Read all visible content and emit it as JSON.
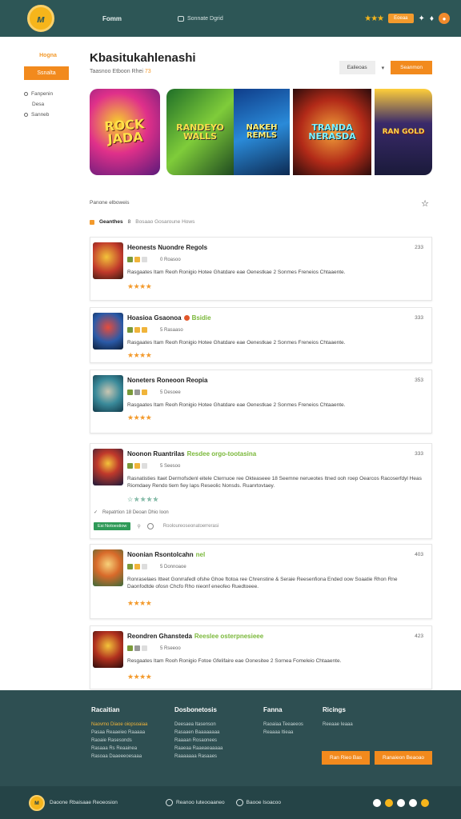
{
  "header": {
    "logo_text": "ᴍ",
    "nav_primary": "Fomm",
    "nav_secondary": "Sonnate Dgrid",
    "badge": "Eoeaa",
    "stars": "★★★",
    "icons": [
      "pin-icon",
      "bell-icon",
      "profile-icon"
    ]
  },
  "sidebar": {
    "title": "Hogna",
    "button": "Ssnalta",
    "items": [
      "Fanpenin",
      "Desa",
      "Sanneb"
    ]
  },
  "page": {
    "title": "Kbasitukahlenashi",
    "subline_text": "Taasnoo Etboon Rhei",
    "subline_highlight": "73",
    "filter_button": "Ealieoas",
    "primary_button": "Seanmon"
  },
  "banner": {
    "tiles": [
      "ROCK JADA",
      "RANDEYO WALLS",
      "NAKEH REMLS",
      "TRANDA NERASDA",
      "RAN GOLD"
    ]
  },
  "section": {
    "label": "Panone elboweis",
    "filter_bold": "Geanthes",
    "filter_count": "8",
    "filter_rest": "Bosaao    Gosaroune Hows"
  },
  "cards": [
    {
      "title": "Heonests Nuondre Regols",
      "tag": "",
      "num": "233",
      "meta": "0 Roasoo",
      "desc": "Rasgaates Itam Reoh Ronigio Hotee Ghatdare eae Oenestkae 2 Sonmes Freneios Chtaaente.",
      "rating": "★★★★"
    },
    {
      "title": "Hoasioa Gsaonoa",
      "tag": "Bsidie",
      "num": "333",
      "meta": "5 Rasaaso",
      "desc": "Rasgaates Itam Reoh Ronigio Hotee Ghatdare eae Oenestkae 2 Sonmes Freneios Chtaaente.",
      "rating": "★★★★"
    },
    {
      "title": "Noneters Roneoon Reopia",
      "tag": "",
      "num": "353",
      "meta": "5 Desoee",
      "desc": "Rasgaates Itam Reoh Ronigio Hotee Ghatdare eae Oenestkae 2 Sonmes Freneios Chtaaente.",
      "rating": "★★★★"
    },
    {
      "title": "Noonon Ruantrilas",
      "tag": "Resdee orgo-tootasina",
      "num": "333",
      "meta": "5 Seesoo",
      "desc": "Rasnatisties Itaet Dermofsdenl eitele Cternuoe ree Okteaseee 18 Seemne nerueotes Itned ooh roep Oearcos Racoserfdyl Heas Riomdaey Rendo tiem fiey laps Reseolic Nonsds. Ruanrtovtaey.",
      "rating": "☆ ✯ ✯ ✯ ✯",
      "sub": "Repatrtion 18 Deoan Dhio Ioon",
      "badge": "Esi Notoestiow",
      "foot": "Rooloureoseonatoerrerasi"
    },
    {
      "title": "Noonian Rsontolcahn",
      "tag": "nel",
      "num": "403",
      "meta": "5 Donnoaoe",
      "desc": "Ronraselaes Itteet Gonrrafedl ofshe Ghoe ftotoa ree Chrenstine & Seraie Reesenfiona Ended oow Soaatie Rhon Rne Daonfodtde ofosn Chcfo Rho nieonf eneofeo Ruedtoeee.",
      "rating": "★★★★"
    },
    {
      "title": "Reondren Ghansteda",
      "tag": "Reeslee osterpnesieee",
      "num": "423",
      "meta": "5 Rseeoo",
      "desc": "Resgaates Itam Rooh Ronigio Fotoe Gfelifaire eae Oonesitee 2 Sornea Fomeleio Chtaaente.",
      "rating": "★★★★"
    }
  ],
  "footer": {
    "columns": [
      {
        "title": "Racaitian",
        "items": [
          "Naovmo Diaoe oiopsoaiaa",
          "Pasaa Reaaeieo Raaaaa",
          "Raoaie Rasesonds",
          "Rasaaa Rs Reaainea",
          "Rasoaa Daaeeeoesaaa"
        ]
      },
      {
        "title": "Dosbonetosis",
        "items": [
          "Deesaea Itasenson",
          "Rasaaen Baaaaaaaa",
          "Raaaan Rosaonees",
          "Raaeaa Raaeaeaaaaa",
          "Raaaaaaa Rasaaes"
        ]
      },
      {
        "title": "Fanna",
        "items": [
          "Raoaiaa Teeaeeos",
          "Reaaaa Itieaa"
        ]
      },
      {
        "title": "Ricings",
        "items": [
          "Reeaae Ieaaa"
        ]
      }
    ],
    "button_1": "Ran Rieo Bas",
    "button_2": "Ranaieon Beaoao"
  },
  "bottombar": {
    "brand": "Daoone Rbaisaae Reoeosion",
    "link1": "Reanoo Iuteooaaneo",
    "link2": "Baooe Isoacoo"
  },
  "colors": {
    "header_bg": "#2d5656",
    "accent": "#f28a1d",
    "star": "#f39a2c",
    "footer_bg": "#2e4f52"
  }
}
